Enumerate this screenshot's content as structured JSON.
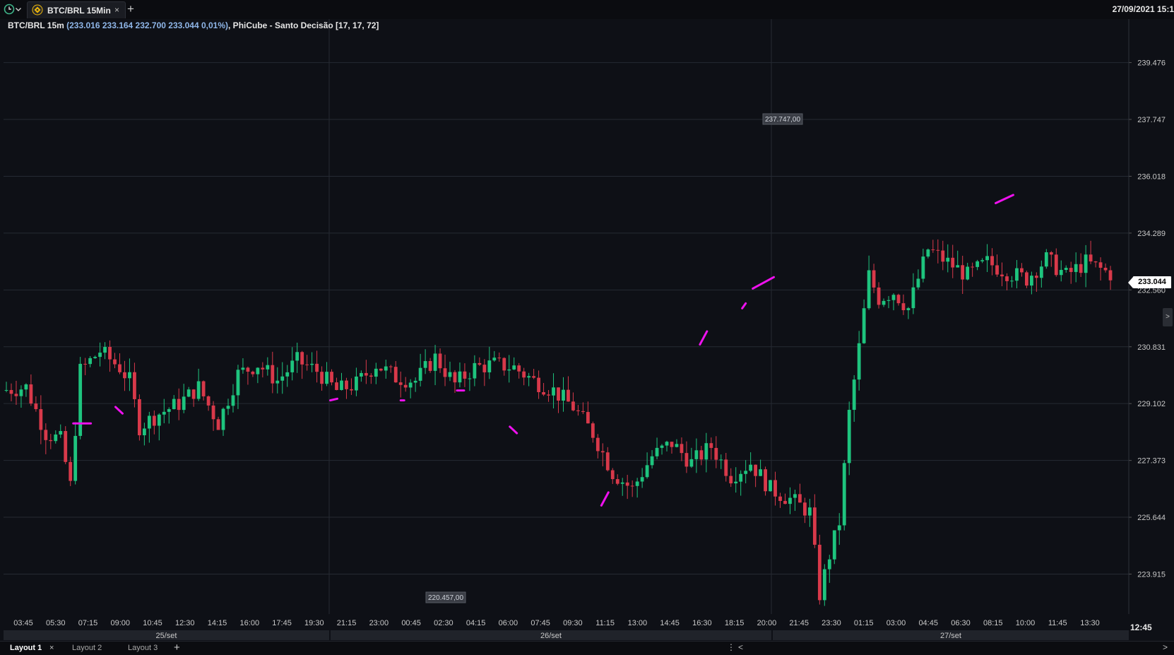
{
  "topbar": {
    "tab_label": "BTC/BRL 15Min",
    "tab_close": "×",
    "add_tab": "+",
    "datetime": "27/09/2021 15:1"
  },
  "legend": {
    "symbol": "BTC/BRL 15m",
    "ohlc": "(233.016  233.164  232.700  233.044  0,01%)",
    "indicator": ", PhiCube - Santo Decisão [17, 17, 72]"
  },
  "price_axis": {
    "labels": [
      "239.476",
      "237.747",
      "236.018",
      "234.289",
      "232.560",
      "230.831",
      "229.102",
      "227.373",
      "225.644",
      "223.915"
    ],
    "current_price": "233.044"
  },
  "time_axis": {
    "labels": [
      "03:45",
      "05:30",
      "07:15",
      "09:00",
      "10:45",
      "12:30",
      "14:15",
      "16:00",
      "17:45",
      "19:30",
      "21:15",
      "23:00",
      "00:45",
      "02:30",
      "04:15",
      "06:00",
      "07:45",
      "09:30",
      "11:15",
      "13:00",
      "14:45",
      "16:30",
      "18:15",
      "20:00",
      "21:45",
      "23:30",
      "01:15",
      "03:00",
      "04:45",
      "06:30",
      "08:15",
      "10:00",
      "11:45",
      "13:30"
    ],
    "current_time": "12:45",
    "dates": [
      "25/set",
      "26/set",
      "27/set"
    ]
  },
  "annotations": {
    "high_label": "237.747,00",
    "low_label": "220.457,00"
  },
  "layouts": [
    "Layout 1",
    "Layout 2",
    "Layout 3"
  ],
  "layout_close": "×",
  "layout_add": "+",
  "scroll_controls": [
    "⋮",
    "<",
    ">"
  ],
  "colors": {
    "background": "#0e1016",
    "grid": "#262a33",
    "up": "#1ec47e",
    "down": "#d8394a",
    "indicator": "#ee11ee",
    "axis_text": "#c8c8c8"
  },
  "chart_data": {
    "type": "candlestick",
    "symbol": "BTC/BRL",
    "interval": "15m",
    "ylim": [
      222.7,
      240.8
    ],
    "y_ticks": [
      239.476,
      237.747,
      236.018,
      234.289,
      232.56,
      230.831,
      229.102,
      227.373,
      225.644,
      223.915
    ],
    "high": 237.747,
    "low": 220.457,
    "last": 233.044,
    "bar_count": 225,
    "anchors": [
      [
        0,
        229.5
      ],
      [
        5,
        229.6
      ],
      [
        9,
        228.2
      ],
      [
        12,
        228.0
      ],
      [
        14,
        226.6
      ],
      [
        16,
        230.1
      ],
      [
        20,
        230.7
      ],
      [
        24,
        230.2
      ],
      [
        26,
        229.8
      ],
      [
        28,
        228.4
      ],
      [
        32,
        228.8
      ],
      [
        36,
        229.1
      ],
      [
        40,
        229.6
      ],
      [
        44,
        228.5
      ],
      [
        48,
        230.0
      ],
      [
        52,
        230.3
      ],
      [
        56,
        229.8
      ],
      [
        60,
        230.4
      ],
      [
        64,
        230.1
      ],
      [
        68,
        229.5
      ],
      [
        72,
        229.7
      ],
      [
        76,
        230.3
      ],
      [
        80,
        229.9
      ],
      [
        84,
        229.8
      ],
      [
        88,
        230.5
      ],
      [
        92,
        229.7
      ],
      [
        96,
        230.2
      ],
      [
        100,
        230.3
      ],
      [
        104,
        230.2
      ],
      [
        108,
        229.8
      ],
      [
        112,
        229.5
      ],
      [
        116,
        229.0
      ],
      [
        120,
        228.2
      ],
      [
        124,
        227.0
      ],
      [
        128,
        226.5
      ],
      [
        132,
        227.5
      ],
      [
        136,
        227.9
      ],
      [
        140,
        227.3
      ],
      [
        144,
        227.8
      ],
      [
        148,
        226.9
      ],
      [
        152,
        227.3
      ],
      [
        156,
        226.5
      ],
      [
        160,
        226.2
      ],
      [
        164,
        225.8
      ],
      [
        166,
        223.3
      ],
      [
        168,
        224.5
      ],
      [
        170,
        225.5
      ],
      [
        172,
        228.8
      ],
      [
        174,
        230.8
      ],
      [
        176,
        233.0
      ],
      [
        178,
        232.3
      ],
      [
        181,
        232.5
      ],
      [
        184,
        232.0
      ],
      [
        188,
        233.8
      ],
      [
        192,
        233.4
      ],
      [
        196,
        233.0
      ],
      [
        200,
        233.4
      ],
      [
        204,
        233.1
      ],
      [
        208,
        232.9
      ],
      [
        212,
        233.5
      ],
      [
        216,
        233.0
      ],
      [
        220,
        233.4
      ],
      [
        225,
        233.05
      ]
    ]
  }
}
